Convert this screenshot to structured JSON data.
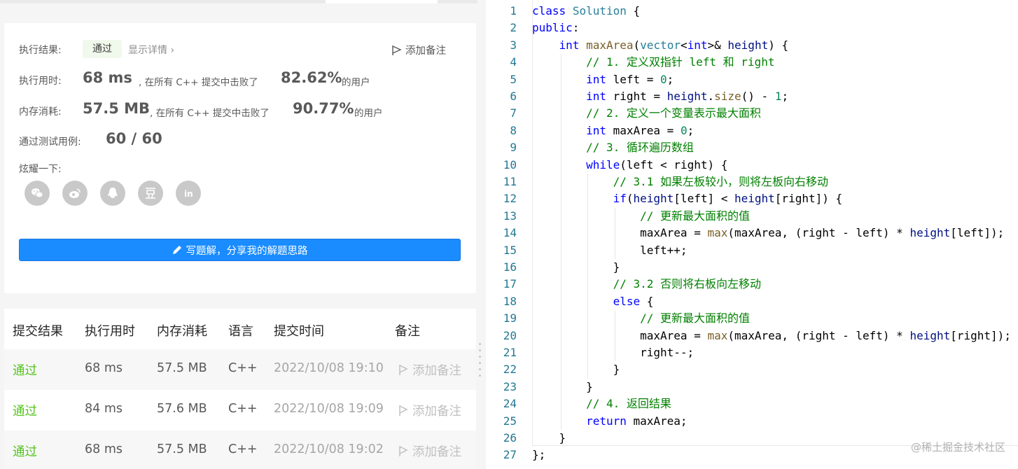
{
  "result": {
    "result_label": "执行结果:",
    "result_status": "通过",
    "detail_link": "显示详情 ›",
    "add_note": "添加备注",
    "runtime_label": "执行用时:",
    "runtime_value": "68 ms",
    "runtime_text": ", 在所有 C++ 提交中击败了",
    "runtime_percent": "82.62%",
    "runtime_suffix": "的用户",
    "memory_label": "内存消耗:",
    "memory_value": "57.5 MB",
    "memory_text": ", 在所有 C++ 提交中击败了",
    "memory_percent": "90.77%",
    "memory_suffix": "的用户",
    "tests_label": "通过测试用例:",
    "tests_value": "60 / 60",
    "share_label": "炫耀一下:",
    "share_icons": [
      "wechat-icon",
      "weibo-icon",
      "qq-icon",
      "douban-icon",
      "linkedin-icon"
    ],
    "solution_button": "写题解，分享我的解题思路"
  },
  "submissions": {
    "headers": [
      "提交结果",
      "执行用时",
      "内存消耗",
      "语言",
      "提交时间",
      "备注"
    ],
    "rows": [
      {
        "status": "通过",
        "runtime": "68 ms",
        "memory": "57.5 MB",
        "lang": "C++",
        "time": "2022/10/08 19:10",
        "note": "添加备注"
      },
      {
        "status": "通过",
        "runtime": "84 ms",
        "memory": "57.6 MB",
        "lang": "C++",
        "time": "2022/10/08 19:09",
        "note": "添加备注"
      },
      {
        "status": "通过",
        "runtime": "68 ms",
        "memory": "57.5 MB",
        "lang": "C++",
        "time": "2022/10/08 19:02",
        "note": "添加备注"
      }
    ]
  },
  "code": {
    "lines": [
      "class Solution {",
      "public:",
      "    int maxArea(vector<int>& height) {",
      "        // 1. 定义双指针 left 和 right",
      "        int left = 0;",
      "        int right = height.size() - 1;",
      "        // 2. 定义一个变量表示最大面积",
      "        int maxArea = 0;",
      "        // 3. 循环遍历数组",
      "        while(left < right) {",
      "            // 3.1 如果左板较小，则将左板向右移动",
      "            if(height[left] < height[right]) {",
      "                // 更新最大面积的值",
      "                maxArea = max(maxArea, (right - left) * height[left]);",
      "                left++;",
      "            }",
      "            // 3.2 否则将右板向左移动",
      "            else {",
      "                // 更新最大面积的值",
      "                maxArea = max(maxArea, (right - left) * height[right]);",
      "                right--;",
      "            }",
      "        }",
      "        // 4. 返回结果",
      "        return maxArea;",
      "    }",
      "};"
    ]
  },
  "watermark": "@稀土掘金技术社区",
  "colors": {
    "accent": "#1a8cff",
    "success": "#52c41a",
    "keyword": "#0000ff",
    "comment": "#008000",
    "type": "#267f99",
    "line_number": "#237893"
  }
}
